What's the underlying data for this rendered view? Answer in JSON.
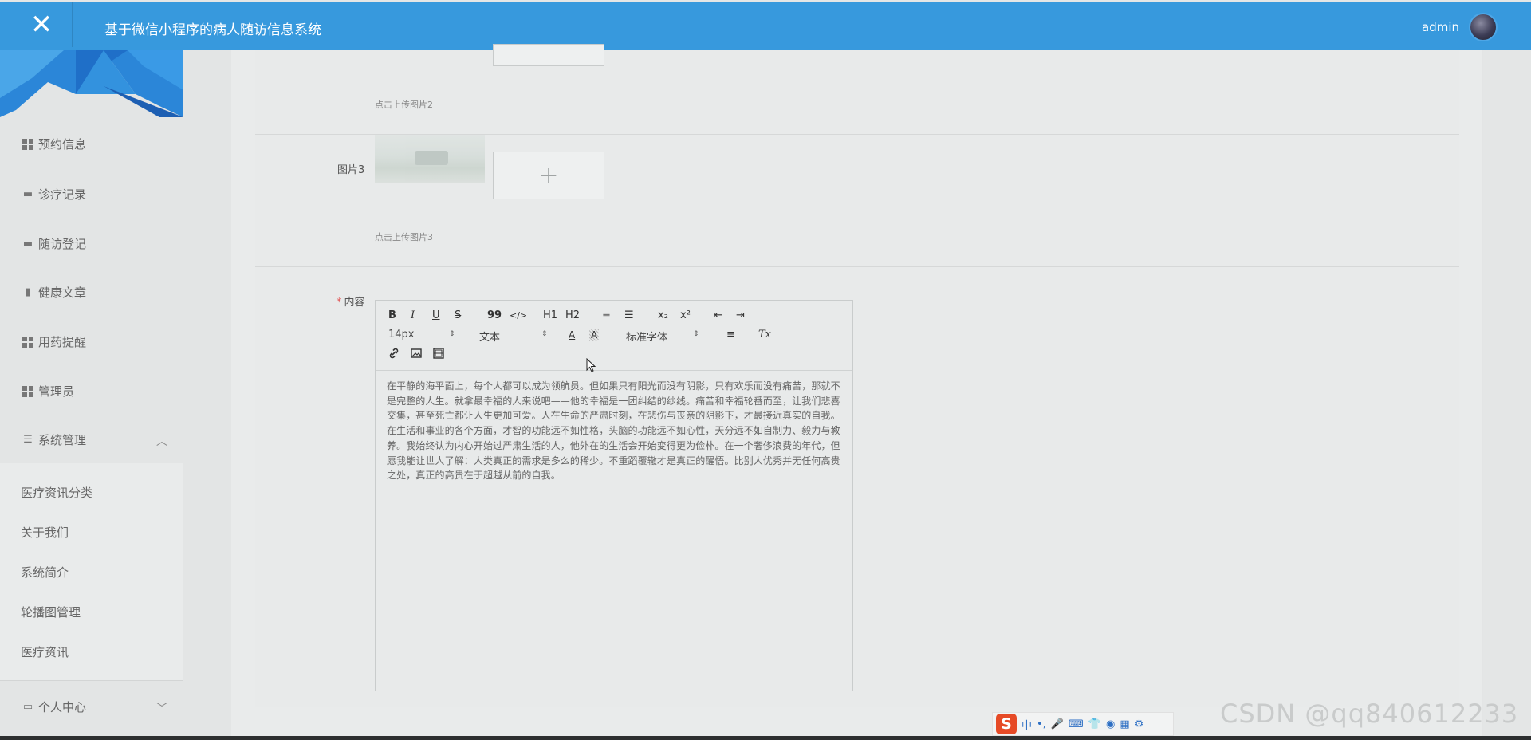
{
  "header": {
    "close_glyph": "✕",
    "title": "基于微信小程序的病人随访信息系统",
    "username": "admin"
  },
  "sidebar": {
    "items": [
      {
        "label": "预约信息",
        "icon": "grid-icon"
      },
      {
        "label": "诊疗记录",
        "icon": "monitor-icon"
      },
      {
        "label": "随访登记",
        "icon": "box-icon"
      },
      {
        "label": "健康文章",
        "icon": "clipboard-icon"
      },
      {
        "label": "用药提醒",
        "icon": "grid-icon"
      },
      {
        "label": "管理员",
        "icon": "grid-icon"
      },
      {
        "label": "系统管理",
        "icon": "sliders-icon",
        "expanded": true
      }
    ],
    "submenu": [
      "医疗资讯分类",
      "关于我们",
      "系统简介",
      "轮播图管理",
      "医疗资讯"
    ],
    "personal_center": "个人中心",
    "chev_up": "︿",
    "chev_down": "﹀"
  },
  "form": {
    "upload_hint_2": "点击上传图片2",
    "image3_label": "图片3",
    "upload_plus": "+",
    "upload_hint_3": "点击上传图片3",
    "content_required": "*",
    "content_label": "内容"
  },
  "editor": {
    "toolbar": {
      "bold": "B",
      "italic": "I",
      "underline": "U",
      "strike": "S",
      "quote": "99",
      "code": "</>",
      "h1": "H1",
      "h2": "H2",
      "ordered_list": "≡",
      "bullet_list": "☰",
      "sub": "x₂",
      "sup": "x²",
      "outdent": "⇤",
      "indent": "⇥",
      "size_value": "14px",
      "style_value": "文本",
      "font_value": "标准字体",
      "color": "A",
      "background": "A",
      "align": "≡",
      "clear": "Tx",
      "select_arrow": "⇕"
    },
    "content": "在平静的海平面上，每个人都可以成为领航员。但如果只有阳光而没有阴影，只有欢乐而没有痛苦，那就不是完整的人生。就拿最幸福的人来说吧——他的幸福是一团纠结的纱线。痛苦和幸福轮番而至，让我们悲喜交集，甚至死亡都让人生更加可爱。人在生命的严肃时刻，在悲伤与丧亲的阴影下，才最接近真实的自我。在生活和事业的各个方面，才智的功能远不如性格，头脑的功能远不如心性，天分远不如自制力、毅力与教养。我始终认为内心开始过严肃生活的人，他外在的生活会开始变得更为俭朴。在一个奢侈浪费的年代，但愿我能让世人了解：人类真正的需求是多么的稀少。不重蹈覆辙才是真正的醒悟。比别人优秀并无任何高贵之处，真正的高贵在于超越从前的自我。"
  },
  "ime": {
    "logo": "S",
    "lang": "中",
    "punct": "•,",
    "mic": "🎤",
    "keyboard": "⌨",
    "skin": "👕",
    "bot": "◉",
    "apps": "▦",
    "settings": "⚙"
  },
  "watermark": "CSDN @qq840612233",
  "colors": {
    "header_bg": "#3799dd",
    "required": "#e25555"
  }
}
